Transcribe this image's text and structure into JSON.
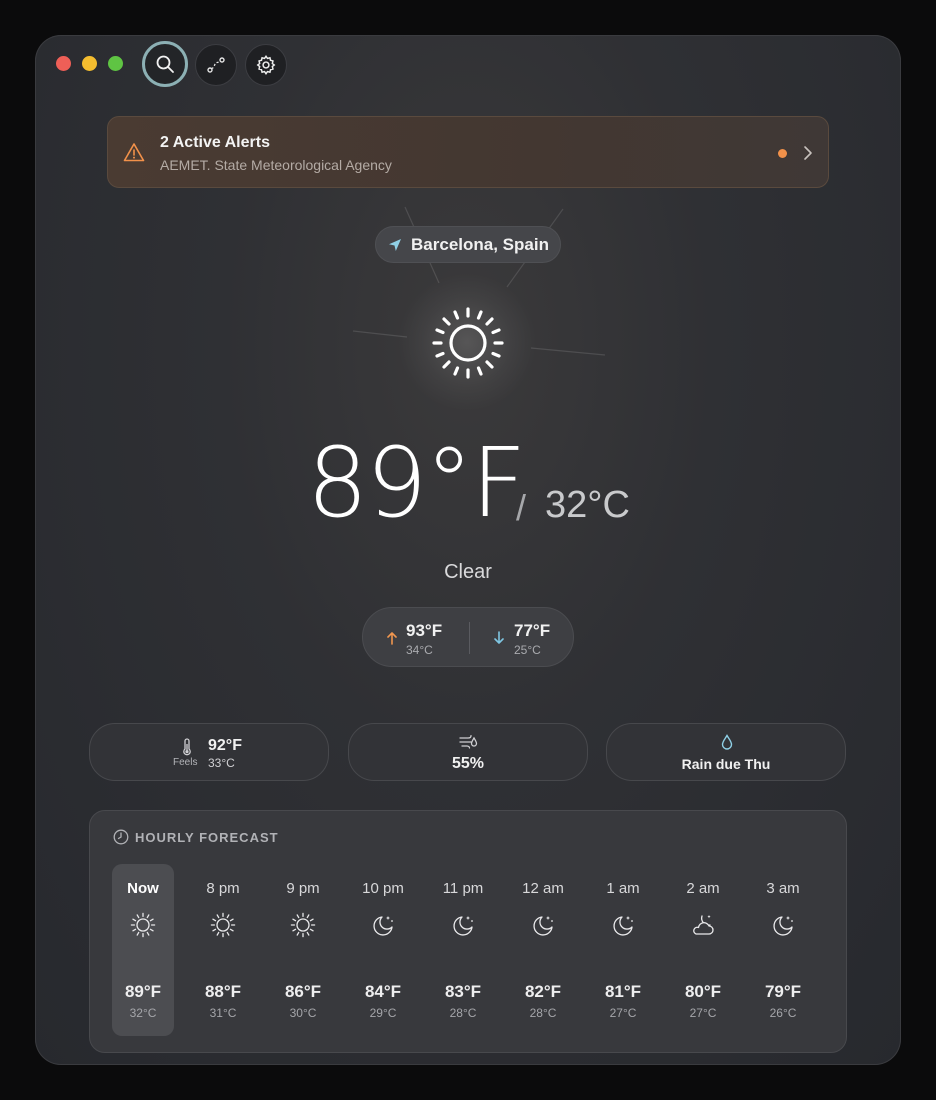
{
  "toolbar": {
    "search_icon": "search-icon",
    "route_icon": "route-icon",
    "settings_icon": "gear-icon"
  },
  "alert": {
    "title": "2 Active Alerts",
    "source": "AEMET. State Meteorological Agency",
    "accent": "#f2914a"
  },
  "location": {
    "name": "Barcelona, Spain"
  },
  "current": {
    "icon": "sun-icon",
    "temp_f": "89°F",
    "separator": "/",
    "temp_c": "32°C",
    "condition": "Clear",
    "high_f": "93°F",
    "high_c": "34°C",
    "low_f": "77°F",
    "low_c": "25°C"
  },
  "stats": {
    "feels_label": "Feels",
    "feels_f": "92°F",
    "feels_c": "33°C",
    "humidity": "55%",
    "rain": "Rain due Thu"
  },
  "hourly": {
    "title": "HOURLY FORECAST",
    "items": [
      {
        "time": "Now",
        "icon": "sun-icon",
        "f": "89°F",
        "c": "32°C"
      },
      {
        "time": "8 pm",
        "icon": "sun-icon",
        "f": "88°F",
        "c": "31°C"
      },
      {
        "time": "9 pm",
        "icon": "sun-icon",
        "f": "86°F",
        "c": "30°C"
      },
      {
        "time": "10 pm",
        "icon": "moon-stars-icon",
        "f": "84°F",
        "c": "29°C"
      },
      {
        "time": "11 pm",
        "icon": "moon-stars-icon",
        "f": "83°F",
        "c": "28°C"
      },
      {
        "time": "12 am",
        "icon": "moon-stars-icon",
        "f": "82°F",
        "c": "28°C"
      },
      {
        "time": "1 am",
        "icon": "moon-stars-icon",
        "f": "81°F",
        "c": "27°C"
      },
      {
        "time": "2 am",
        "icon": "cloud-moon-icon",
        "f": "80°F",
        "c": "27°C"
      },
      {
        "time": "3 am",
        "icon": "moon-stars-icon",
        "f": "79°F",
        "c": "26°C"
      }
    ]
  }
}
